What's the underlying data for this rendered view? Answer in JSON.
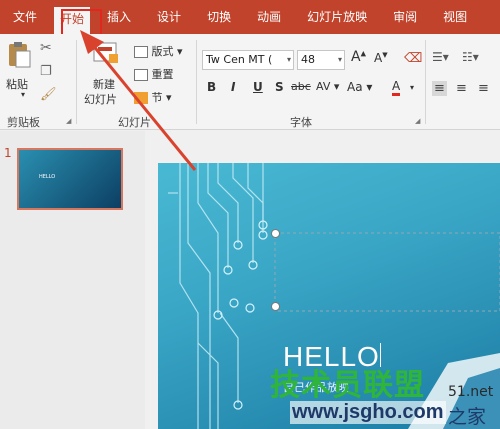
{
  "tabs": [
    "文件",
    "开始",
    "插入",
    "设计",
    "切换",
    "动画",
    "幻灯片放映",
    "审阅",
    "视图"
  ],
  "ribbon": {
    "clipboard": {
      "paste": "粘贴",
      "label": "剪贴板"
    },
    "slides": {
      "new_slide_line1": "新建",
      "new_slide_line2": "幻灯片",
      "layout": "版式",
      "reset": "重置",
      "section": "节",
      "label": "幻灯片"
    },
    "font": {
      "family": "Tw Cen MT (",
      "size": "48",
      "label": "字体",
      "bold": "B",
      "italic": "I",
      "underline": "U",
      "shadow": "S",
      "strike": "abc",
      "spacing": "AV",
      "case": "Aa",
      "color": "A",
      "grow": "A",
      "shrink": "A"
    }
  },
  "slide_pane": {
    "number": "1",
    "thumb_text": "HELLO"
  },
  "slide": {
    "title": "HELLO",
    "subtitle": "自己作品放映"
  },
  "watermark": {
    "line1": "技术员联盟",
    "line2": "www.jsgho.com",
    "suffix": "之家",
    "suffix_top": "51.net"
  }
}
